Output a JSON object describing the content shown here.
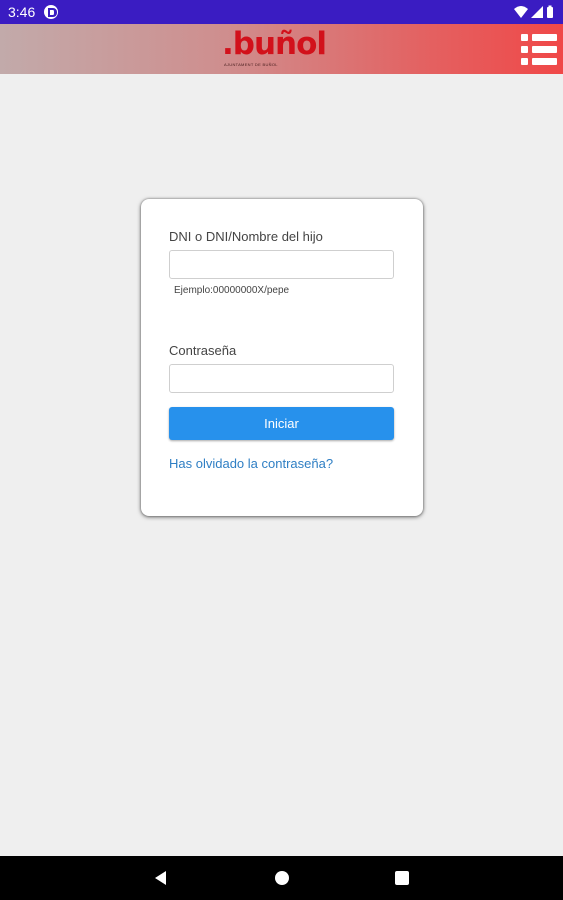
{
  "status_bar": {
    "time": "3:46",
    "notification_icon": "pocket-p-icon",
    "icons": [
      "wifi-icon",
      "signal-icon",
      "battery-icon"
    ],
    "background": "#3a1cc2"
  },
  "header": {
    "logo": {
      "text": "buñol",
      "subtitle": "AJUNTAMENT DE BUÑOL",
      "color": "#d2111b"
    },
    "menu_icon": "list-menu-icon"
  },
  "login": {
    "username_label": "DNI o DNI/Nombre del hijo",
    "username_value": "",
    "username_placeholder": "",
    "username_hint": "Ejemplo:00000000X/pepe",
    "password_label": "Contraseña",
    "password_value": "",
    "password_placeholder": "",
    "submit_label": "Iniciar",
    "forgot_link": "Has olvidado la contraseña?",
    "accent_color": "#2791ec",
    "link_color": "#2f7fc4"
  },
  "nav_bar": {
    "icons": [
      "back-icon",
      "home-icon",
      "recents-icon"
    ]
  }
}
